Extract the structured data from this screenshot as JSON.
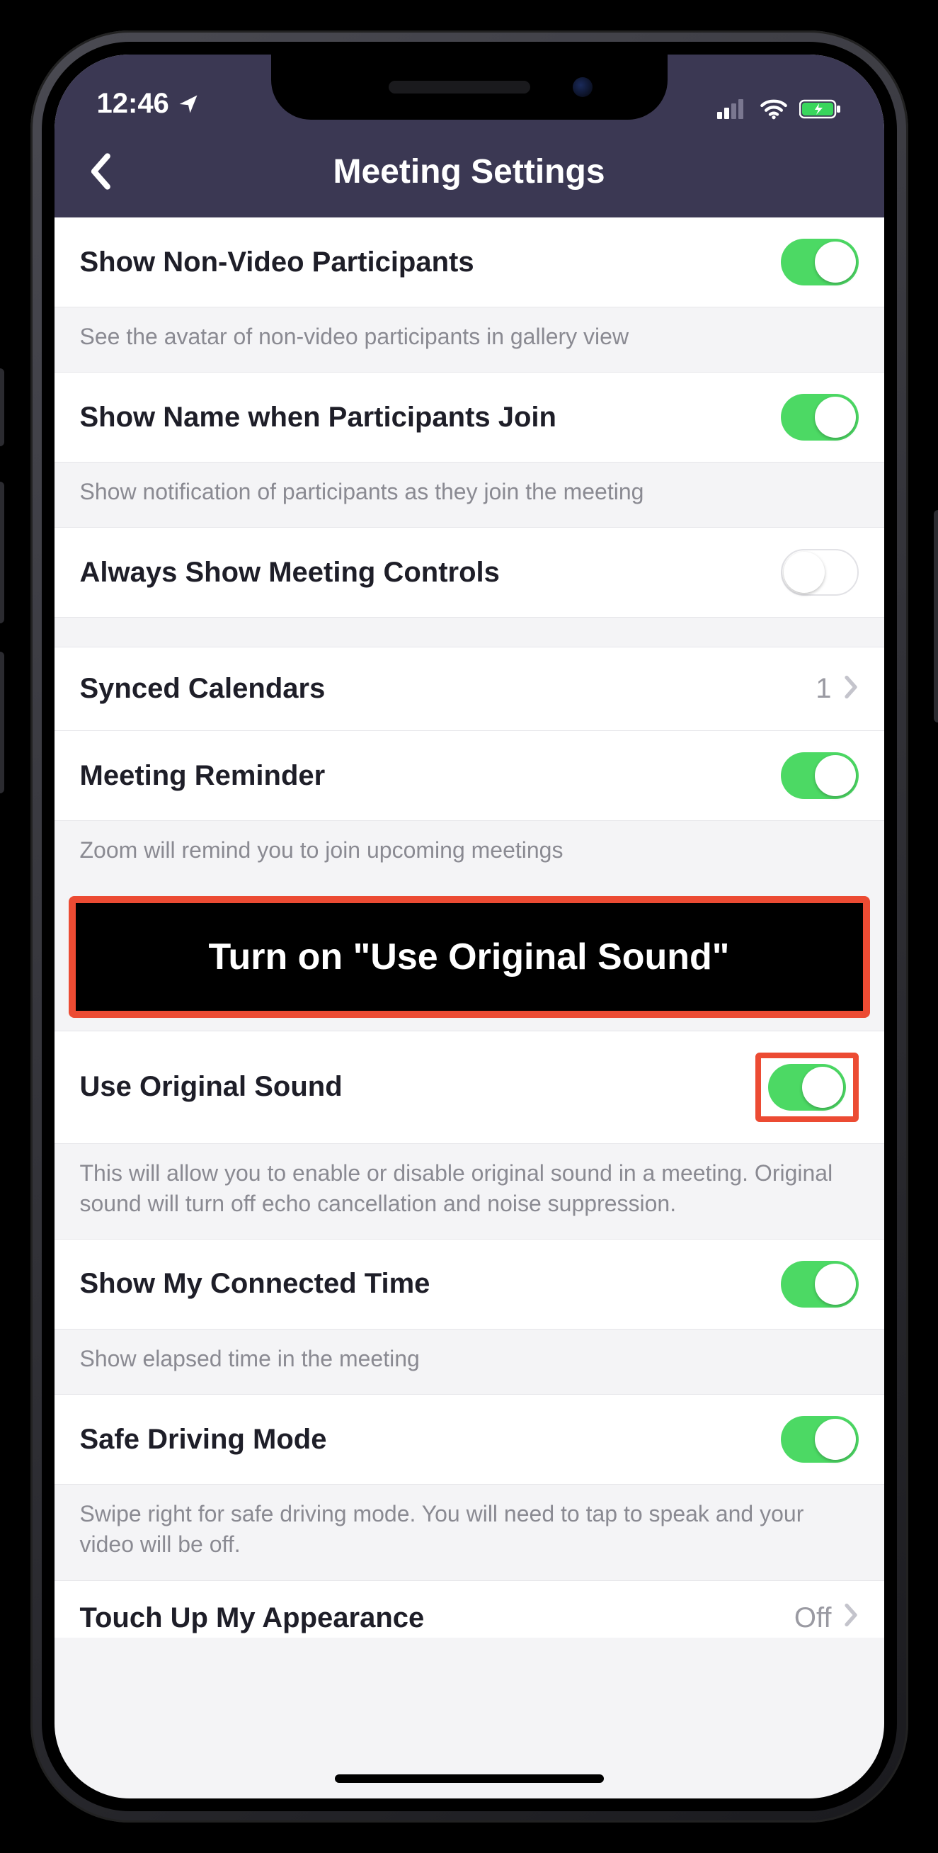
{
  "status": {
    "time": "12:46",
    "location_icon": "location-arrow",
    "signal_icon": "dual-sim-signal",
    "wifi_icon": "wifi",
    "battery_icon": "battery-charging"
  },
  "nav": {
    "back_icon": "chevron-left",
    "title": "Meeting Settings"
  },
  "callout": {
    "text": "Turn on \"Use Original Sound\""
  },
  "settings": [
    {
      "key": "show_non_video",
      "label": "Show Non-Video Participants",
      "type": "toggle",
      "value": true,
      "desc": "See the avatar of non-video participants in gallery view"
    },
    {
      "key": "show_name_join",
      "label": "Show Name when Participants Join",
      "type": "toggle",
      "value": true,
      "desc": "Show notification of participants as they join the meeting"
    },
    {
      "key": "always_show_controls",
      "label": "Always Show Meeting Controls",
      "type": "toggle",
      "value": false
    },
    {
      "key": "synced_calendars",
      "label": "Synced Calendars",
      "type": "nav",
      "value_text": "1"
    },
    {
      "key": "meeting_reminder",
      "label": "Meeting Reminder",
      "type": "toggle",
      "value": true,
      "desc": "Zoom will remind you to join upcoming meetings"
    },
    {
      "key": "use_original_sound",
      "label": "Use Original Sound",
      "type": "toggle",
      "value": true,
      "highlight": true,
      "desc": "This will allow you to enable or disable original sound in a meeting. Original sound will turn off echo cancellation and noise suppression."
    },
    {
      "key": "show_connected_time",
      "label": "Show My Connected Time",
      "type": "toggle",
      "value": true,
      "desc": "Show elapsed time in the meeting"
    },
    {
      "key": "safe_driving_mode",
      "label": "Safe Driving Mode",
      "type": "toggle",
      "value": true,
      "desc": "Swipe right for safe driving mode. You will need to tap to speak and your video will be off."
    },
    {
      "key": "touch_up_appearance",
      "label": "Touch Up My Appearance",
      "type": "nav",
      "value_text": "Off",
      "cut": true
    }
  ]
}
